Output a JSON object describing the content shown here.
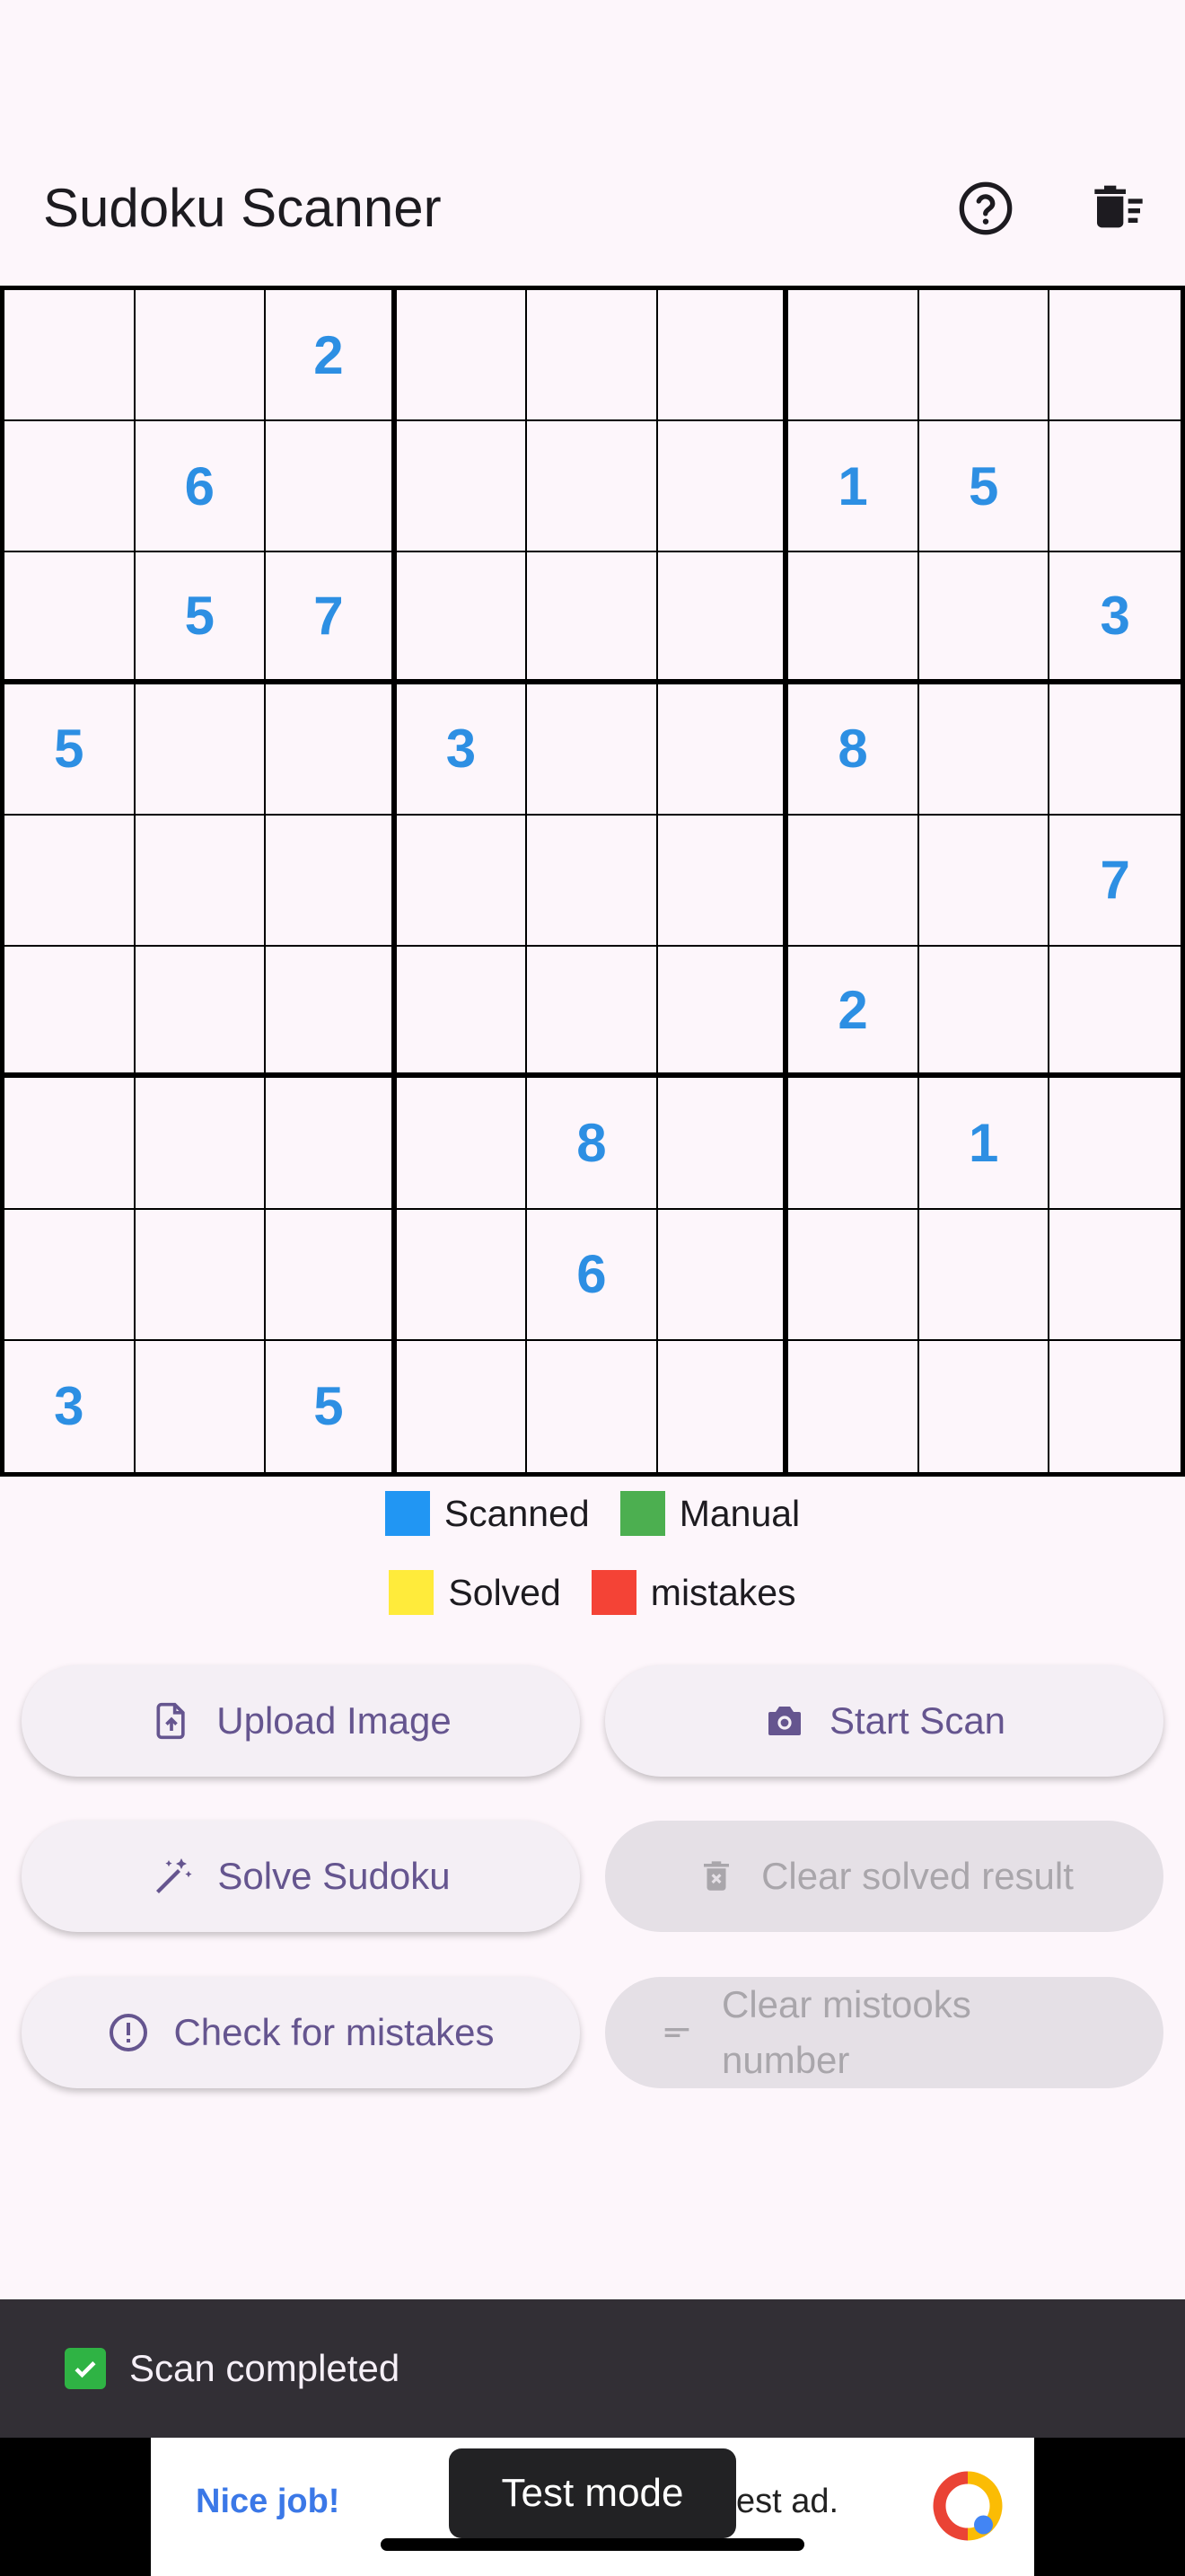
{
  "app": {
    "title": "Sudoku Scanner",
    "help_icon": "help-circle-icon",
    "trash_icon": "delete-sweep-icon"
  },
  "board": {
    "grid": [
      [
        "",
        "",
        "2",
        "",
        "",
        "",
        "",
        "",
        ""
      ],
      [
        "",
        "6",
        "",
        "",
        "",
        "",
        "1",
        "5",
        ""
      ],
      [
        "",
        "5",
        "7",
        "",
        "",
        "",
        "",
        "",
        "3"
      ],
      [
        "5",
        "",
        "",
        "3",
        "",
        "",
        "8",
        "",
        ""
      ],
      [
        "",
        "",
        "",
        "",
        "",
        "",
        "",
        "",
        "7"
      ],
      [
        "",
        "",
        "",
        "",
        "",
        "",
        "2",
        "",
        ""
      ],
      [
        "",
        "",
        "",
        "",
        "8",
        "",
        "",
        "1",
        ""
      ],
      [
        "",
        "",
        "",
        "",
        "6",
        "",
        "",
        "",
        ""
      ],
      [
        "3",
        "",
        "5",
        "",
        "",
        "",
        "",
        "",
        ""
      ]
    ],
    "scanned_color": "#2d8fe3"
  },
  "legend": {
    "scanned": {
      "label": "Scanned",
      "color": "#2196f3"
    },
    "manual": {
      "label": "Manual",
      "color": "#4caf50"
    },
    "solved": {
      "label": "Solved",
      "color": "#ffeb3b"
    },
    "mistakes": {
      "label": "mistakes",
      "color": "#f44336"
    }
  },
  "buttons": {
    "upload": {
      "label": "Upload Image",
      "icon": "upload-file-icon"
    },
    "start_scan": {
      "label": "Start Scan",
      "icon": "camera-icon"
    },
    "solve": {
      "label": "Solve Sudoku",
      "icon": "magic-wand-icon"
    },
    "clear_solved": {
      "label": "Clear solved result",
      "icon": "delete-icon"
    },
    "check_mistakes": {
      "label": "Check for mistakes",
      "icon": "error-outline-icon"
    },
    "clear_mistakes": {
      "label": "Clear mistooks number",
      "icon": "short-text-icon"
    }
  },
  "snackbar": {
    "text": "Scan completed",
    "icon": "check-box-icon"
  },
  "ad": {
    "left_text": "Nice job!",
    "right_text": "est ad.",
    "test_mode": "Test mode",
    "logo": "ad-logo-icon"
  },
  "colors": {
    "accent": "#65558f",
    "background": "#fdf6fb",
    "snackbar": "#322f35"
  }
}
